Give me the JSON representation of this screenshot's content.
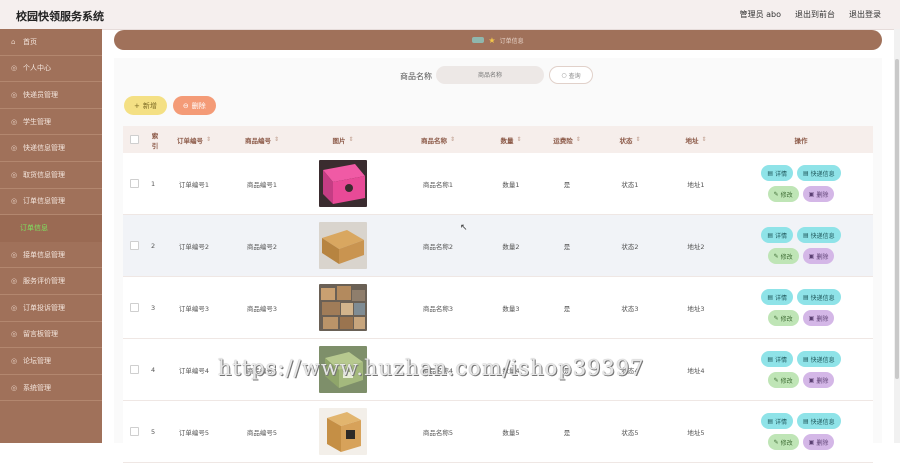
{
  "header": {
    "title": "校园快领服务系统",
    "links": [
      "管理员 abo",
      "退出到前台",
      "退出登录"
    ]
  },
  "sidebar": {
    "items": [
      {
        "label": "首页",
        "icon": "home-icon"
      },
      {
        "label": "个人中心",
        "icon": "user-icon"
      },
      {
        "label": "快递员管理",
        "icon": "courier-icon"
      },
      {
        "label": "学生管理",
        "icon": "student-icon"
      },
      {
        "label": "快递信息管理",
        "icon": "package-icon"
      },
      {
        "label": "取货信息管理",
        "icon": "pickup-icon"
      },
      {
        "label": "订单信息管理",
        "icon": "order-icon"
      },
      {
        "label": "订单信息",
        "icon": "",
        "sub": true
      },
      {
        "label": "接单信息管理",
        "icon": "accept-icon"
      },
      {
        "label": "服务评价管理",
        "icon": "review-icon"
      },
      {
        "label": "订单投诉管理",
        "icon": "complaint-icon"
      },
      {
        "label": "留言板管理",
        "icon": "message-icon"
      },
      {
        "label": "论坛管理",
        "icon": "forum-icon"
      },
      {
        "label": "系统管理",
        "icon": "settings-icon"
      }
    ]
  },
  "breadcrumb": {
    "current": "订单信息"
  },
  "search": {
    "label": "商品名称",
    "placeholder": "商品名称",
    "button": "查询"
  },
  "actions": {
    "add": "新增",
    "delete": "删除"
  },
  "table": {
    "headers": [
      "索引",
      "订单编号",
      "商品编号",
      "图片",
      "商品名称",
      "数量",
      "运费险",
      "状态",
      "地址",
      "操作"
    ],
    "rows": [
      {
        "idx": "1",
        "order": "订单编号1",
        "goods": "商品编号1",
        "name": "商品名称1",
        "qty": "数量1",
        "fee": "是",
        "status": "状态1",
        "addr": "地址1"
      },
      {
        "idx": "2",
        "order": "订单编号2",
        "goods": "商品编号2",
        "name": "商品名称2",
        "qty": "数量2",
        "fee": "是",
        "status": "状态2",
        "addr": "地址2"
      },
      {
        "idx": "3",
        "order": "订单编号3",
        "goods": "商品编号3",
        "name": "商品名称3",
        "qty": "数量3",
        "fee": "是",
        "status": "状态3",
        "addr": "地址3"
      },
      {
        "idx": "4",
        "order": "订单编号4",
        "goods": "商品编号4",
        "name": "商品名称4",
        "qty": "数量4",
        "fee": "是",
        "status": "状态4",
        "addr": "地址4"
      },
      {
        "idx": "5",
        "order": "订单编号5",
        "goods": "商品编号5",
        "name": "商品名称5",
        "qty": "数量5",
        "fee": "是",
        "status": "状态5",
        "addr": "地址5"
      }
    ],
    "ops": {
      "detail": "详情",
      "ship": "快递信息",
      "edit": "修改",
      "del": "删除"
    }
  },
  "watermark": "https://www.huzhan.com/ishop39397",
  "colors": {
    "sidebar": "#a0715a",
    "header": "#f5efee",
    "accent_add": "#f4e084",
    "accent_del": "#f49b77"
  }
}
